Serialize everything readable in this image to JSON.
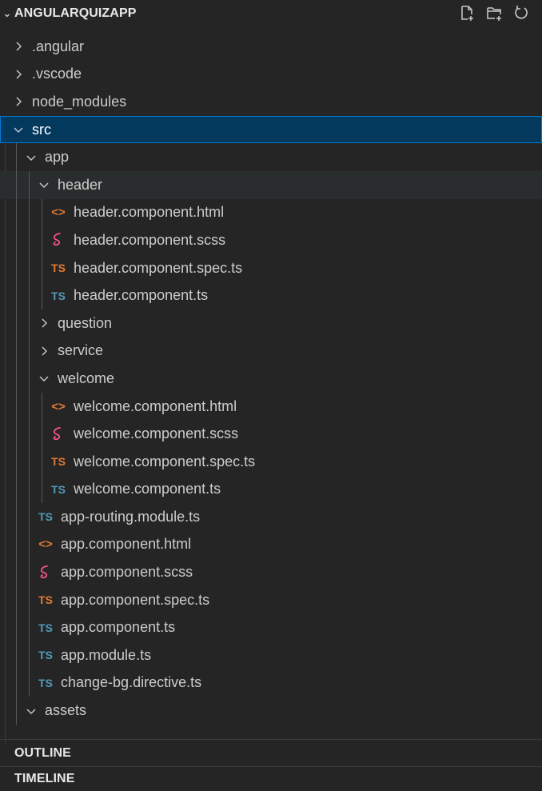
{
  "explorer": {
    "title": "ANGULARQUIZAPP",
    "actions": [
      {
        "name": "new-file",
        "icon": "new-file-icon"
      },
      {
        "name": "new-folder",
        "icon": "new-folder-icon"
      },
      {
        "name": "refresh",
        "icon": "refresh-icon"
      }
    ]
  },
  "tree": [
    {
      "label": ".angular",
      "type": "folder",
      "expanded": false,
      "depth": 0
    },
    {
      "label": ".vscode",
      "type": "folder",
      "expanded": false,
      "depth": 0
    },
    {
      "label": "node_modules",
      "type": "folder",
      "expanded": false,
      "depth": 0
    },
    {
      "label": "src",
      "type": "folder",
      "expanded": true,
      "depth": 0,
      "selected": true
    },
    {
      "label": "app",
      "type": "folder",
      "expanded": true,
      "depth": 1
    },
    {
      "label": "header",
      "type": "folder",
      "expanded": true,
      "depth": 2,
      "hover": true
    },
    {
      "label": "header.component.html",
      "type": "html",
      "depth": 3
    },
    {
      "label": "header.component.scss",
      "type": "scss",
      "depth": 3
    },
    {
      "label": "header.component.spec.ts",
      "type": "ts-spec",
      "depth": 3
    },
    {
      "label": "header.component.ts",
      "type": "ts",
      "depth": 3
    },
    {
      "label": "question",
      "type": "folder",
      "expanded": false,
      "depth": 2
    },
    {
      "label": "service",
      "type": "folder",
      "expanded": false,
      "depth": 2
    },
    {
      "label": "welcome",
      "type": "folder",
      "expanded": true,
      "depth": 2
    },
    {
      "label": "welcome.component.html",
      "type": "html",
      "depth": 3
    },
    {
      "label": "welcome.component.scss",
      "type": "scss",
      "depth": 3
    },
    {
      "label": "welcome.component.spec.ts",
      "type": "ts-spec",
      "depth": 3
    },
    {
      "label": "welcome.component.ts",
      "type": "ts",
      "depth": 3
    },
    {
      "label": "app-routing.module.ts",
      "type": "ts",
      "depth": 2
    },
    {
      "label": "app.component.html",
      "type": "html",
      "depth": 2
    },
    {
      "label": "app.component.scss",
      "type": "scss",
      "depth": 2
    },
    {
      "label": "app.component.spec.ts",
      "type": "ts-spec",
      "depth": 2
    },
    {
      "label": "app.component.ts",
      "type": "ts",
      "depth": 2
    },
    {
      "label": "app.module.ts",
      "type": "ts",
      "depth": 2
    },
    {
      "label": "change-bg.directive.ts",
      "type": "ts",
      "depth": 2
    },
    {
      "label": "assets",
      "type": "folder",
      "expanded": true,
      "depth": 1
    }
  ],
  "icons": {
    "ts_text": "TS",
    "html_glyph": "<>"
  },
  "panels": {
    "outline": "OUTLINE",
    "timeline": "TIMELINE"
  },
  "colors": {
    "background": "#252526",
    "selected_bg": "#04395e",
    "selected_border": "#0078d4",
    "ts_blue": "#519aba",
    "ts_orange": "#e37933",
    "html_orange": "#e37933",
    "scss_pink": "#f55385"
  }
}
